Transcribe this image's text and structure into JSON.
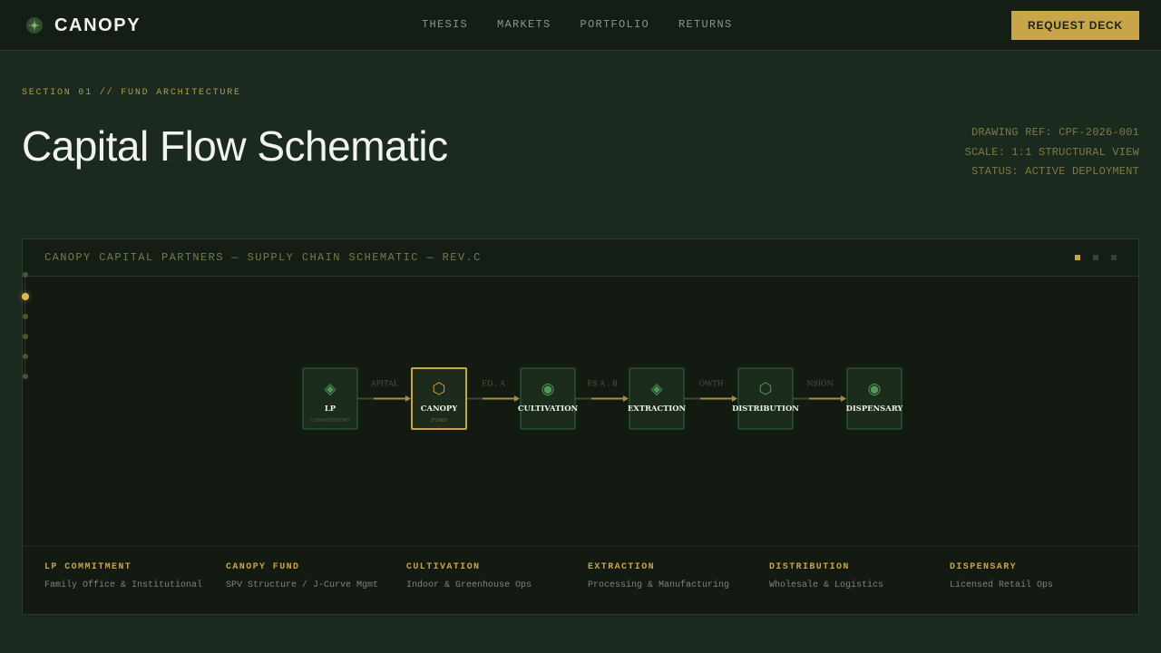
{
  "nav": {
    "brand": "CANOPY",
    "links": [
      "THESIS",
      "MARKETS",
      "PORTFOLIO",
      "RETURNS"
    ],
    "cta": "REQUEST DECK"
  },
  "header": {
    "eyebrow": "SECTION 01 // FUND ARCHITECTURE",
    "title": "Capital Flow Schematic",
    "meta": [
      "DRAWING REF: CPF-2026-001",
      "SCALE: 1:1 STRUCTURAL VIEW",
      "STATUS: ACTIVE DEPLOYMENT"
    ]
  },
  "panel": {
    "title": "CANOPY CAPITAL PARTNERS — SUPPLY CHAIN SCHEMATIC — REV.C",
    "nodes": [
      {
        "name": "LP",
        "sub": "COMMITMENT",
        "icon": "diamond-icon",
        "glyph": "◈",
        "highlight": false
      },
      {
        "name": "CANOPY",
        "sub": "FUND",
        "icon": "hexagon-icon",
        "glyph": "⬡",
        "highlight": true
      },
      {
        "name": "CULTIVATION",
        "sub": "",
        "icon": "circle-dot-icon",
        "glyph": "◉",
        "highlight": false
      },
      {
        "name": "EXTRACTION",
        "sub": "",
        "icon": "diamond-icon",
        "glyph": "◈",
        "highlight": false
      },
      {
        "name": "DISTRIBUTION",
        "sub": "",
        "icon": "hexagon-icon",
        "glyph": "⬡",
        "highlight": false
      },
      {
        "name": "DISPENSARY",
        "sub": "",
        "icon": "circle-dot-icon",
        "glyph": "◉",
        "highlight": false
      }
    ],
    "connector_labels": [
      "APITAL",
      "ED . A",
      "ES A . B",
      "OWTH",
      "NSION"
    ],
    "legend": [
      {
        "label": "LP COMMITMENT",
        "desc": "Family Office & Institutional"
      },
      {
        "label": "CANOPY FUND",
        "desc": "SPV Structure / J-Curve Mgmt"
      },
      {
        "label": "CULTIVATION",
        "desc": "Indoor & Greenhouse Ops"
      },
      {
        "label": "EXTRACTION",
        "desc": "Processing & Manufacturing"
      },
      {
        "label": "DISTRIBUTION",
        "desc": "Wholesale & Logistics"
      },
      {
        "label": "DISPENSARY",
        "desc": "Licensed Retail Ops"
      }
    ]
  },
  "colors": {
    "accent": "#c9a54a",
    "node_icon": "#4f9a56",
    "node_fill": "#1b2c1d",
    "node_border": "#2f5a34",
    "background": "#1b2a1e"
  }
}
